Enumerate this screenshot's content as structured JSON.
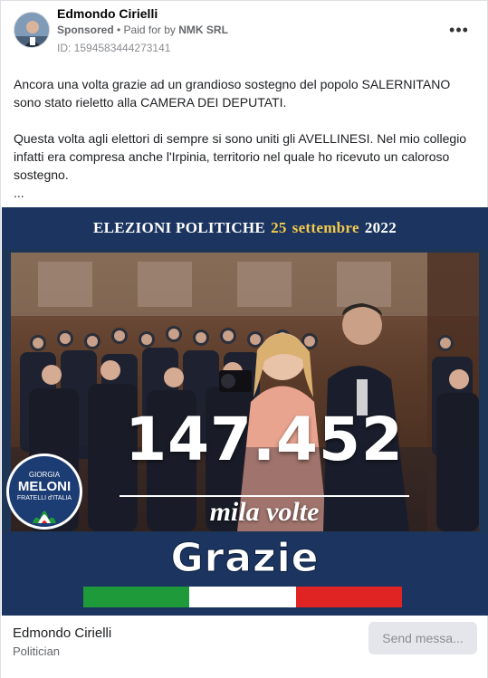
{
  "post": {
    "author": "Edmondo Cirielli",
    "sponsored_label": "Sponsored",
    "paid_prefix": " • Paid for by ",
    "payer": "NMK SRL",
    "ad_id": "ID: 1594583444273141",
    "more_icon": "more-horizontal-icon",
    "more_label": "•••"
  },
  "body": {
    "paragraph_1": "Ancora una volta grazie ad un grandioso sostegno del popolo SALERNITANO sono stato rieletto alla CAMERA DEI DEPUTATI.",
    "paragraph_2": "Questa volta agli elettori di sempre si sono uniti gli AVELLINESI. Nel mio collegio infatti era compresa anche l'Irpinia, territorio nel quale ho ricevuto un caloroso sostegno.",
    "ellipsis": "..."
  },
  "creative": {
    "title_start": "ELEZIONI POLITICHE",
    "title_day": "25",
    "title_month": "settembre",
    "title_year": "2022",
    "big_number": "147.452",
    "subtitle": "mila volte",
    "thanks": "Grazie",
    "logo_line_1": "GIORGIA",
    "logo_line_2": "MELONI",
    "logo_line_3": "FRATELLI d'ITALIA",
    "flag_colors": [
      "#1e9a3a",
      "#ffffff",
      "#e02424"
    ]
  },
  "footer": {
    "name": "Edmondo Cirielli",
    "category": "Politician",
    "button_label": "Send messa..."
  }
}
